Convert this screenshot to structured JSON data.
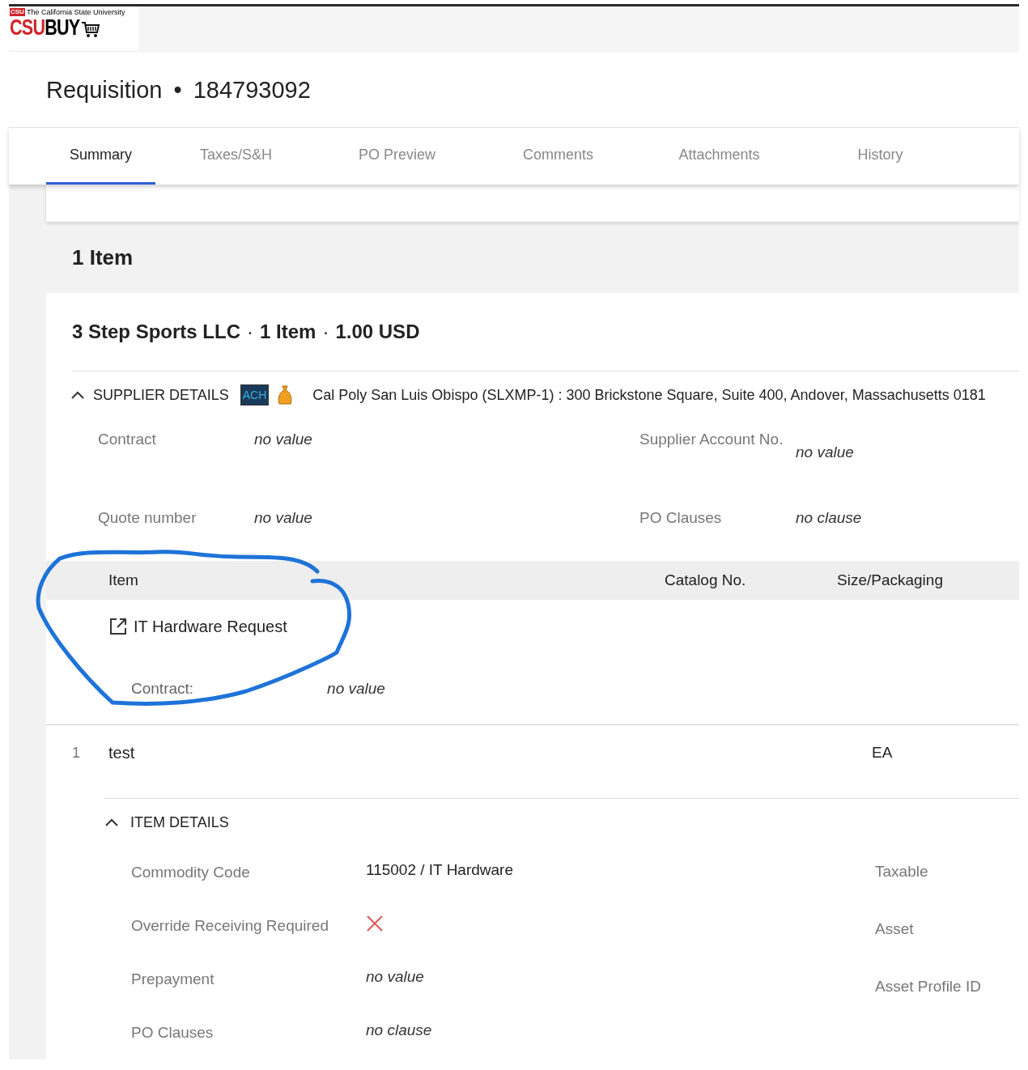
{
  "logo": {
    "badge": "CSU",
    "tagline": "The California State University",
    "wordmark_red": "CSU",
    "wordmark_black": "BUY"
  },
  "header": {
    "title": "Requisition",
    "separator": "•",
    "number": "184793092"
  },
  "tabs": [
    {
      "label": "Summary",
      "selected": true
    },
    {
      "label": "Taxes/S&H",
      "selected": false
    },
    {
      "label": "PO Preview",
      "selected": false
    },
    {
      "label": "Comments",
      "selected": false
    },
    {
      "label": "Attachments",
      "selected": false
    },
    {
      "label": "History",
      "selected": false
    }
  ],
  "section_title": "1 Item",
  "supplier": {
    "name": "3 Step Sports LLC",
    "separator": "·",
    "item_count": "1 Item",
    "total": "1.00 USD"
  },
  "supplier_details": {
    "label": "SUPPLIER DETAILS",
    "expanded": true,
    "payment_badge": "ACH",
    "address": "Cal Poly San Luis Obispo (SLXMP-1) : 300 Brickstone Square, Suite 400, Andover, Massachusetts 0181",
    "fields": [
      {
        "label": "Contract",
        "value": "no value",
        "kind": "empty"
      },
      {
        "label": "Supplier Account No.",
        "value": "no value",
        "kind": "empty"
      },
      {
        "label": "Quote number",
        "value": "no value",
        "kind": "empty"
      },
      {
        "label": "PO Clauses",
        "value": "no clause",
        "kind": "empty"
      }
    ]
  },
  "table": {
    "columns": [
      "Item",
      "Catalog No.",
      "Size/Packaging"
    ]
  },
  "item_group": {
    "title": "IT Hardware Request",
    "contract_label": "Contract:",
    "contract_value": "no value"
  },
  "lines": [
    {
      "number": "1",
      "description": "test",
      "unit": "EA"
    }
  ],
  "item_details": {
    "label": "ITEM DETAILS",
    "expanded": true,
    "fields": [
      {
        "label": "Commodity Code",
        "value": "115002 / IT Hardware",
        "kind": "text"
      },
      {
        "label": "Override Receiving Required",
        "kind": "cross"
      },
      {
        "label": "Prepayment",
        "value": "no value",
        "kind": "empty"
      },
      {
        "label": "PO Clauses",
        "value": "no clause",
        "kind": "empty"
      }
    ],
    "right_labels": [
      "Taxable",
      "Asset",
      "Asset Profile ID"
    ]
  }
}
